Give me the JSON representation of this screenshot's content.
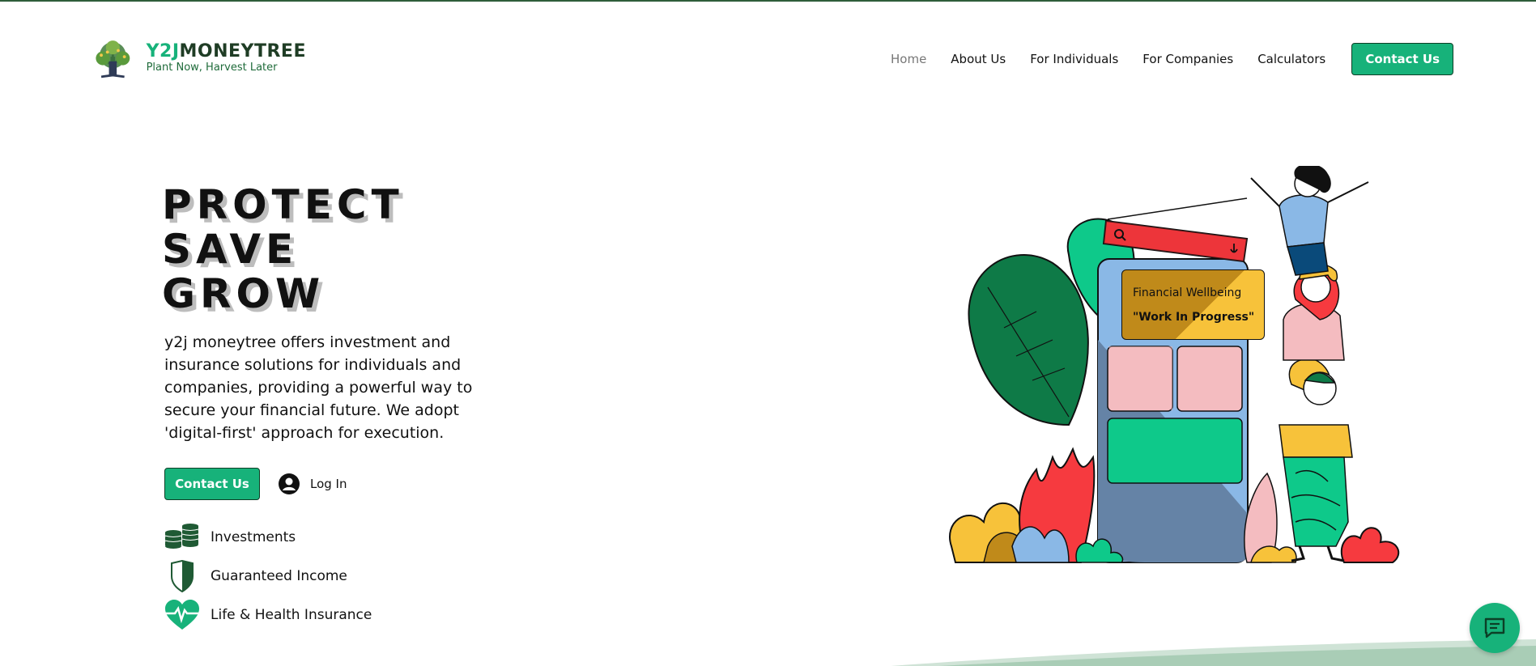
{
  "brand": {
    "name_prefix": "Y2J",
    "name_suffix": "MONEYTREE",
    "tagline": "Plant Now, Harvest Later",
    "accent_color": "#17b27a",
    "dark_green": "#1f3d25"
  },
  "nav": {
    "items": [
      "Home",
      "About Us",
      "For Individuals",
      "For Companies",
      "Calculators"
    ],
    "active": "Home",
    "cta_label": "Contact Us"
  },
  "hero": {
    "title_lines": [
      "PROTECT",
      "SAVE",
      "GROW"
    ],
    "description": "y2j moneytree offers investment and insurance solutions for individuals and companies, providing a powerful way to secure your financial future. We adopt 'digital-first' approach for execution.",
    "cta_label": "Contact Us",
    "login_label": "Log In"
  },
  "features": [
    {
      "label": "Investments",
      "icon": "coins-stack-icon"
    },
    {
      "label": "Guaranteed Income",
      "icon": "shield-icon"
    },
    {
      "label": "Life & Health Insurance",
      "icon": "heart-pulse-icon"
    }
  ],
  "illustration": {
    "bubble_line1": "Financial Wellbeing",
    "bubble_line2": "\"Work In Progress\""
  },
  "chat": {
    "icon": "chat-icon"
  }
}
